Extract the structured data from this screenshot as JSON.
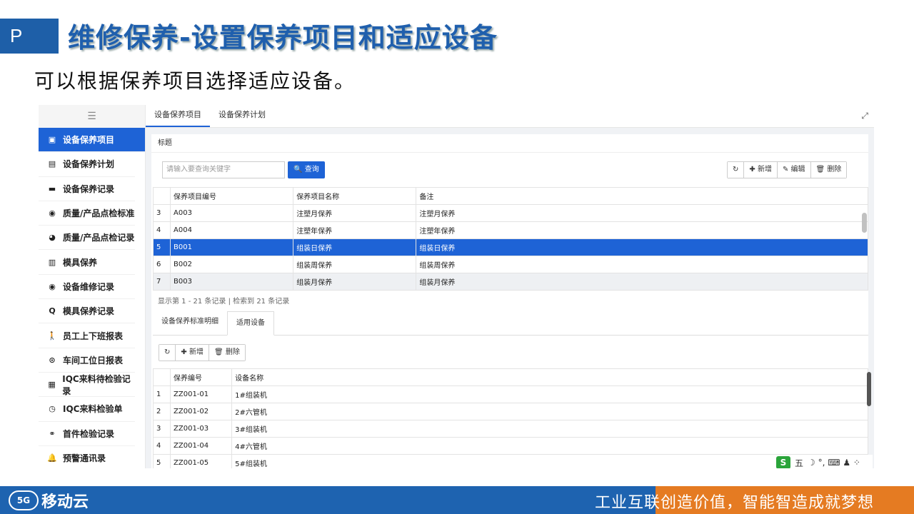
{
  "slide": {
    "badge": "P",
    "title": "维修保养-设置保养项目和适应设备",
    "subtitle": "可以根据保养项目选择适应设备。",
    "footer_text": "工业互联创造价值，智能智造成就梦想",
    "logo_text": "移动云",
    "logo_mark": "5G"
  },
  "sidebar": {
    "toggle_icon": "menu-collapse-icon",
    "items": [
      {
        "label": "设备保养项目",
        "icon": "clipboard-icon",
        "glyph": "▣",
        "active": true
      },
      {
        "label": "设备保养计划",
        "icon": "id-card-icon",
        "glyph": "▤"
      },
      {
        "label": "设备保养记录",
        "icon": "card-icon",
        "glyph": "▬"
      },
      {
        "label": "质量/产品点检标准",
        "icon": "compass-icon",
        "glyph": "◉"
      },
      {
        "label": "质量/产品点检记录",
        "icon": "dashboard-icon",
        "glyph": "◕"
      },
      {
        "label": "模具保养",
        "icon": "bar-chart-icon",
        "glyph": "▥"
      },
      {
        "label": "设备维修记录",
        "icon": "compass-icon",
        "glyph": "◉"
      },
      {
        "label": "模具保养记录",
        "icon": "search-icon",
        "glyph": "Q"
      },
      {
        "label": "员工上下班报表",
        "icon": "walking-icon",
        "glyph": "🚶"
      },
      {
        "label": "车间工位日报表",
        "icon": "target-icon",
        "glyph": "⊙"
      },
      {
        "label": "IQC来料待检验记录",
        "icon": "map-icon",
        "glyph": "▦"
      },
      {
        "label": "IQC来料检验单",
        "icon": "clock-icon",
        "glyph": "◷"
      },
      {
        "label": "首件检验记录",
        "icon": "handshake-icon",
        "glyph": "⚭"
      },
      {
        "label": "预警通讯录",
        "icon": "bell-icon",
        "glyph": "🔔"
      }
    ]
  },
  "tabs": [
    "设备保养项目",
    "设备保养计划"
  ],
  "expand_glyph": "⤢",
  "panel": {
    "title": "标题",
    "search_placeholder": "请输入要查询关键字",
    "query_label": "🔍 查询",
    "toolbar": {
      "refresh": "↻",
      "add": "✚ 新增",
      "edit": "✎ 编辑",
      "delete": "🗑 删除"
    },
    "table": {
      "headers": [
        "",
        "保养项目编号",
        "保养项目名称",
        "备注"
      ],
      "rows": [
        [
          "3",
          "A003",
          "注塑月保养",
          "注塑月保养"
        ],
        [
          "4",
          "A004",
          "注塑年保养",
          "注塑年保养"
        ],
        [
          "5",
          "B001",
          "组装日保养",
          "组装日保养"
        ],
        [
          "6",
          "B002",
          "组装周保养",
          "组装周保养"
        ],
        [
          "7",
          "B003",
          "组装月保养",
          "组装月保养"
        ]
      ]
    },
    "summary": "显示第 1 - 21 条记录 | 检索到 21 条记录",
    "subtabs": [
      "设备保养标准明细",
      "适用设备"
    ],
    "sub_toolbar": {
      "refresh": "↻",
      "add": "✚ 新增",
      "delete": "🗑 删除"
    },
    "sub_table": {
      "headers": [
        "",
        "保养编号",
        "设备名称"
      ],
      "rows": [
        [
          "1",
          "ZZ001-01",
          "1#组装机"
        ],
        [
          "2",
          "ZZ001-02",
          "2#六管机"
        ],
        [
          "3",
          "ZZ001-03",
          "3#组装机"
        ],
        [
          "4",
          "ZZ001-04",
          "4#六管机"
        ],
        [
          "5",
          "ZZ001-05",
          "5#组装机"
        ]
      ]
    }
  },
  "ime": {
    "logo": "S",
    "label": "五",
    "icons": "☽ °, ⌨ ♟ ⁘"
  }
}
